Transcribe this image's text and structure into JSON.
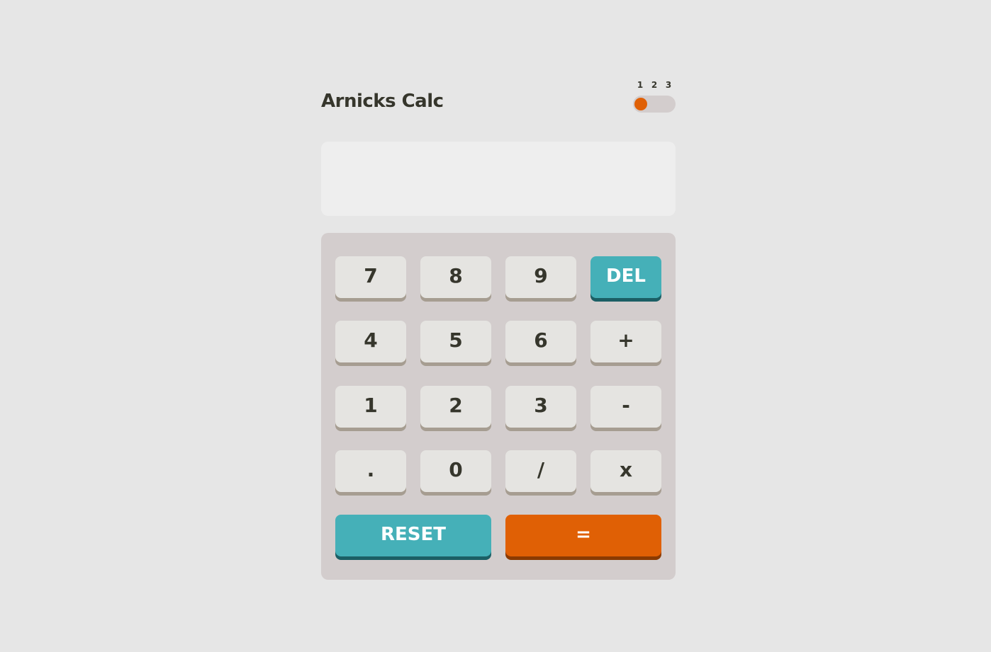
{
  "app": {
    "title": "Arnicks Calc"
  },
  "theme_switch": {
    "labels": [
      "1",
      "2",
      "3"
    ],
    "selected": "1",
    "knob_color": "#e06005"
  },
  "display": {
    "value": ""
  },
  "keys": {
    "k7": "7",
    "k8": "8",
    "k9": "9",
    "del": "DEL",
    "k4": "4",
    "k5": "5",
    "k6": "6",
    "plus": "+",
    "k1": "1",
    "k2": "2",
    "k3": "3",
    "minus": "-",
    "dot": ".",
    "k0": "0",
    "divide": "/",
    "multiply": "x",
    "reset": "RESET",
    "equals": "="
  },
  "colors": {
    "background": "#e6e6e6",
    "keypad": "#d3cdcd",
    "screen": "#eeeeee",
    "key": "#e5e4e1",
    "accent_teal": "#45b0b8",
    "accent_orange": "#e06005",
    "text": "#36362c"
  }
}
